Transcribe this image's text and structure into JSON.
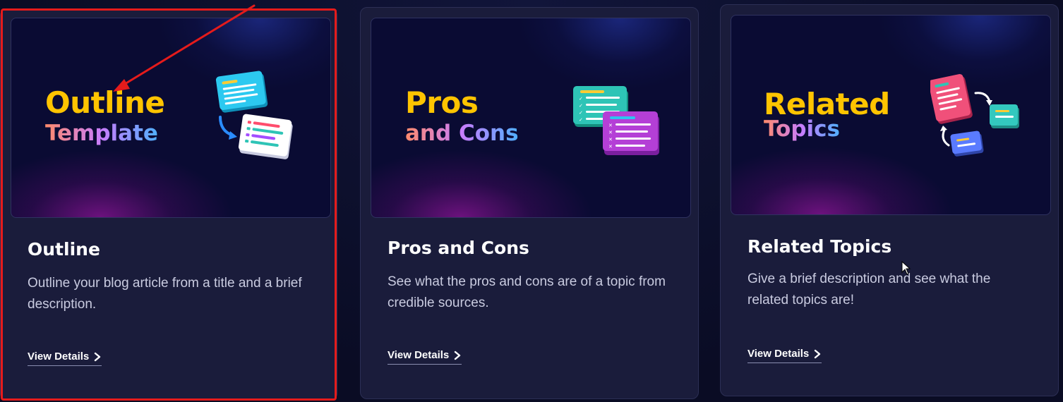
{
  "cards": [
    {
      "thumb_title": "Outline",
      "thumb_subtitle": "Template",
      "title": "Outline",
      "description": "Outline your blog article from a title and a brief description.",
      "link_label": "View Details"
    },
    {
      "thumb_title": "Pros",
      "thumb_subtitle": "and Cons",
      "title": "Pros and Cons",
      "description": "See what the pros and cons are of a topic from credible sources.",
      "link_label": "View Details"
    },
    {
      "thumb_title": "Related",
      "thumb_subtitle": "Topics",
      "title": "Related Topics",
      "description": "Give a brief description and see what the related topics are!",
      "link_label": "View Details"
    }
  ],
  "icons": {
    "chevron": "chevron-right-icon",
    "outline_illustration": "document-list-illustration",
    "pros_cons_illustration": "checklist-illustration",
    "related_illustration": "linked-documents-illustration",
    "cursor": "mouse-pointer-icon"
  },
  "colors": {
    "page_bg": "#0b0d26",
    "card_bg": "#1a1c3b",
    "thumb_title": "#ffc400",
    "highlight": "#e51b1b"
  }
}
